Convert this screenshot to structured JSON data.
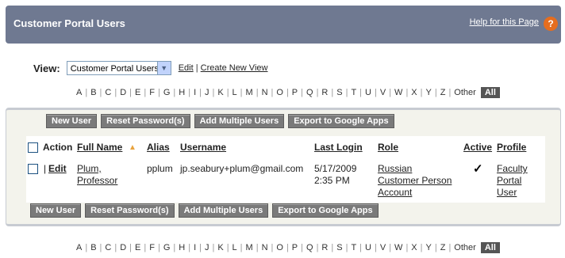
{
  "header": {
    "title": "Customer Portal Users",
    "help_link": "Help for this Page",
    "help_icon": "?"
  },
  "view": {
    "label": "View:",
    "selected": "Customer Portal Users",
    "edit": "Edit",
    "divider": "|",
    "create": "Create New View"
  },
  "alphabet": {
    "letters": [
      "A",
      "B",
      "C",
      "D",
      "E",
      "F",
      "G",
      "H",
      "I",
      "J",
      "K",
      "L",
      "M",
      "N",
      "O",
      "P",
      "Q",
      "R",
      "S",
      "T",
      "U",
      "V",
      "W",
      "X",
      "Y",
      "Z"
    ],
    "other": "Other",
    "all": "All"
  },
  "buttons": {
    "new_user": "New User",
    "reset_password": "Reset Password(s)",
    "add_multiple": "Add Multiple Users",
    "export": "Export to Google Apps"
  },
  "table": {
    "columns": {
      "action": "Action",
      "full_name": "Full Name",
      "alias": "Alias",
      "username": "Username",
      "last_login": "Last Login",
      "role": "Role",
      "active": "Active",
      "profile": "Profile"
    },
    "sort_indicator": "▲",
    "rows": [
      {
        "action_sep": "|",
        "action_edit": "Edit",
        "full_name_1": "Plum,",
        "full_name_2": "Professor",
        "alias": "pplum",
        "username": "jp.seabury+plum@gmail.com",
        "last_login_1": "5/17/2009",
        "last_login_2": "2:35 PM",
        "role_1": "Russian",
        "role_2": "Customer Person",
        "role_3": "Account",
        "active": "✓",
        "profile_1": "Faculty",
        "profile_2": "Portal",
        "profile_3": "User"
      }
    ]
  }
}
